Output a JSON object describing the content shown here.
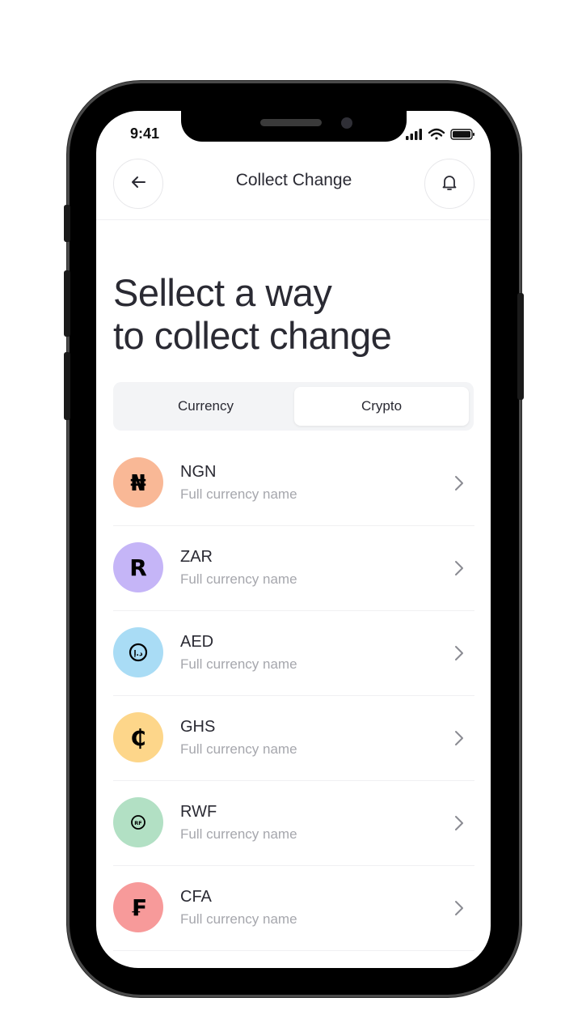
{
  "status_bar": {
    "time": "9:41"
  },
  "header": {
    "title": "Collect Change",
    "back_icon": "arrow-left-icon",
    "notification_icon": "bell-icon"
  },
  "heading": {
    "line1": "Sellect a way",
    "line2": "to collect change"
  },
  "tabs": [
    {
      "label": "Currency",
      "active": false
    },
    {
      "label": "Crypto",
      "active": true
    }
  ],
  "currencies": [
    {
      "code": "NGN",
      "name": "Full currency name",
      "symbol": "₦",
      "color": "#f9b896"
    },
    {
      "code": "ZAR",
      "name": "Full currency name",
      "symbol": "R",
      "color": "#c5b5f7"
    },
    {
      "code": "AED",
      "name": "Full currency name",
      "symbol": "د.إ",
      "color": "#a9dcf5"
    },
    {
      "code": "GHS",
      "name": "Full currency name",
      "symbol": "₵",
      "color": "#fdd68a"
    },
    {
      "code": "RWF",
      "name": "Full currency name",
      "symbol": "RF",
      "color": "#b2e0c4"
    },
    {
      "code": "CFA",
      "name": "Full currency name",
      "symbol": "₣",
      "color": "#f79a9a"
    }
  ],
  "colors": {
    "text_primary": "#2a2a33",
    "text_secondary": "#a6a7ad",
    "frame": "#000000",
    "segment_bg": "#f3f4f6"
  }
}
